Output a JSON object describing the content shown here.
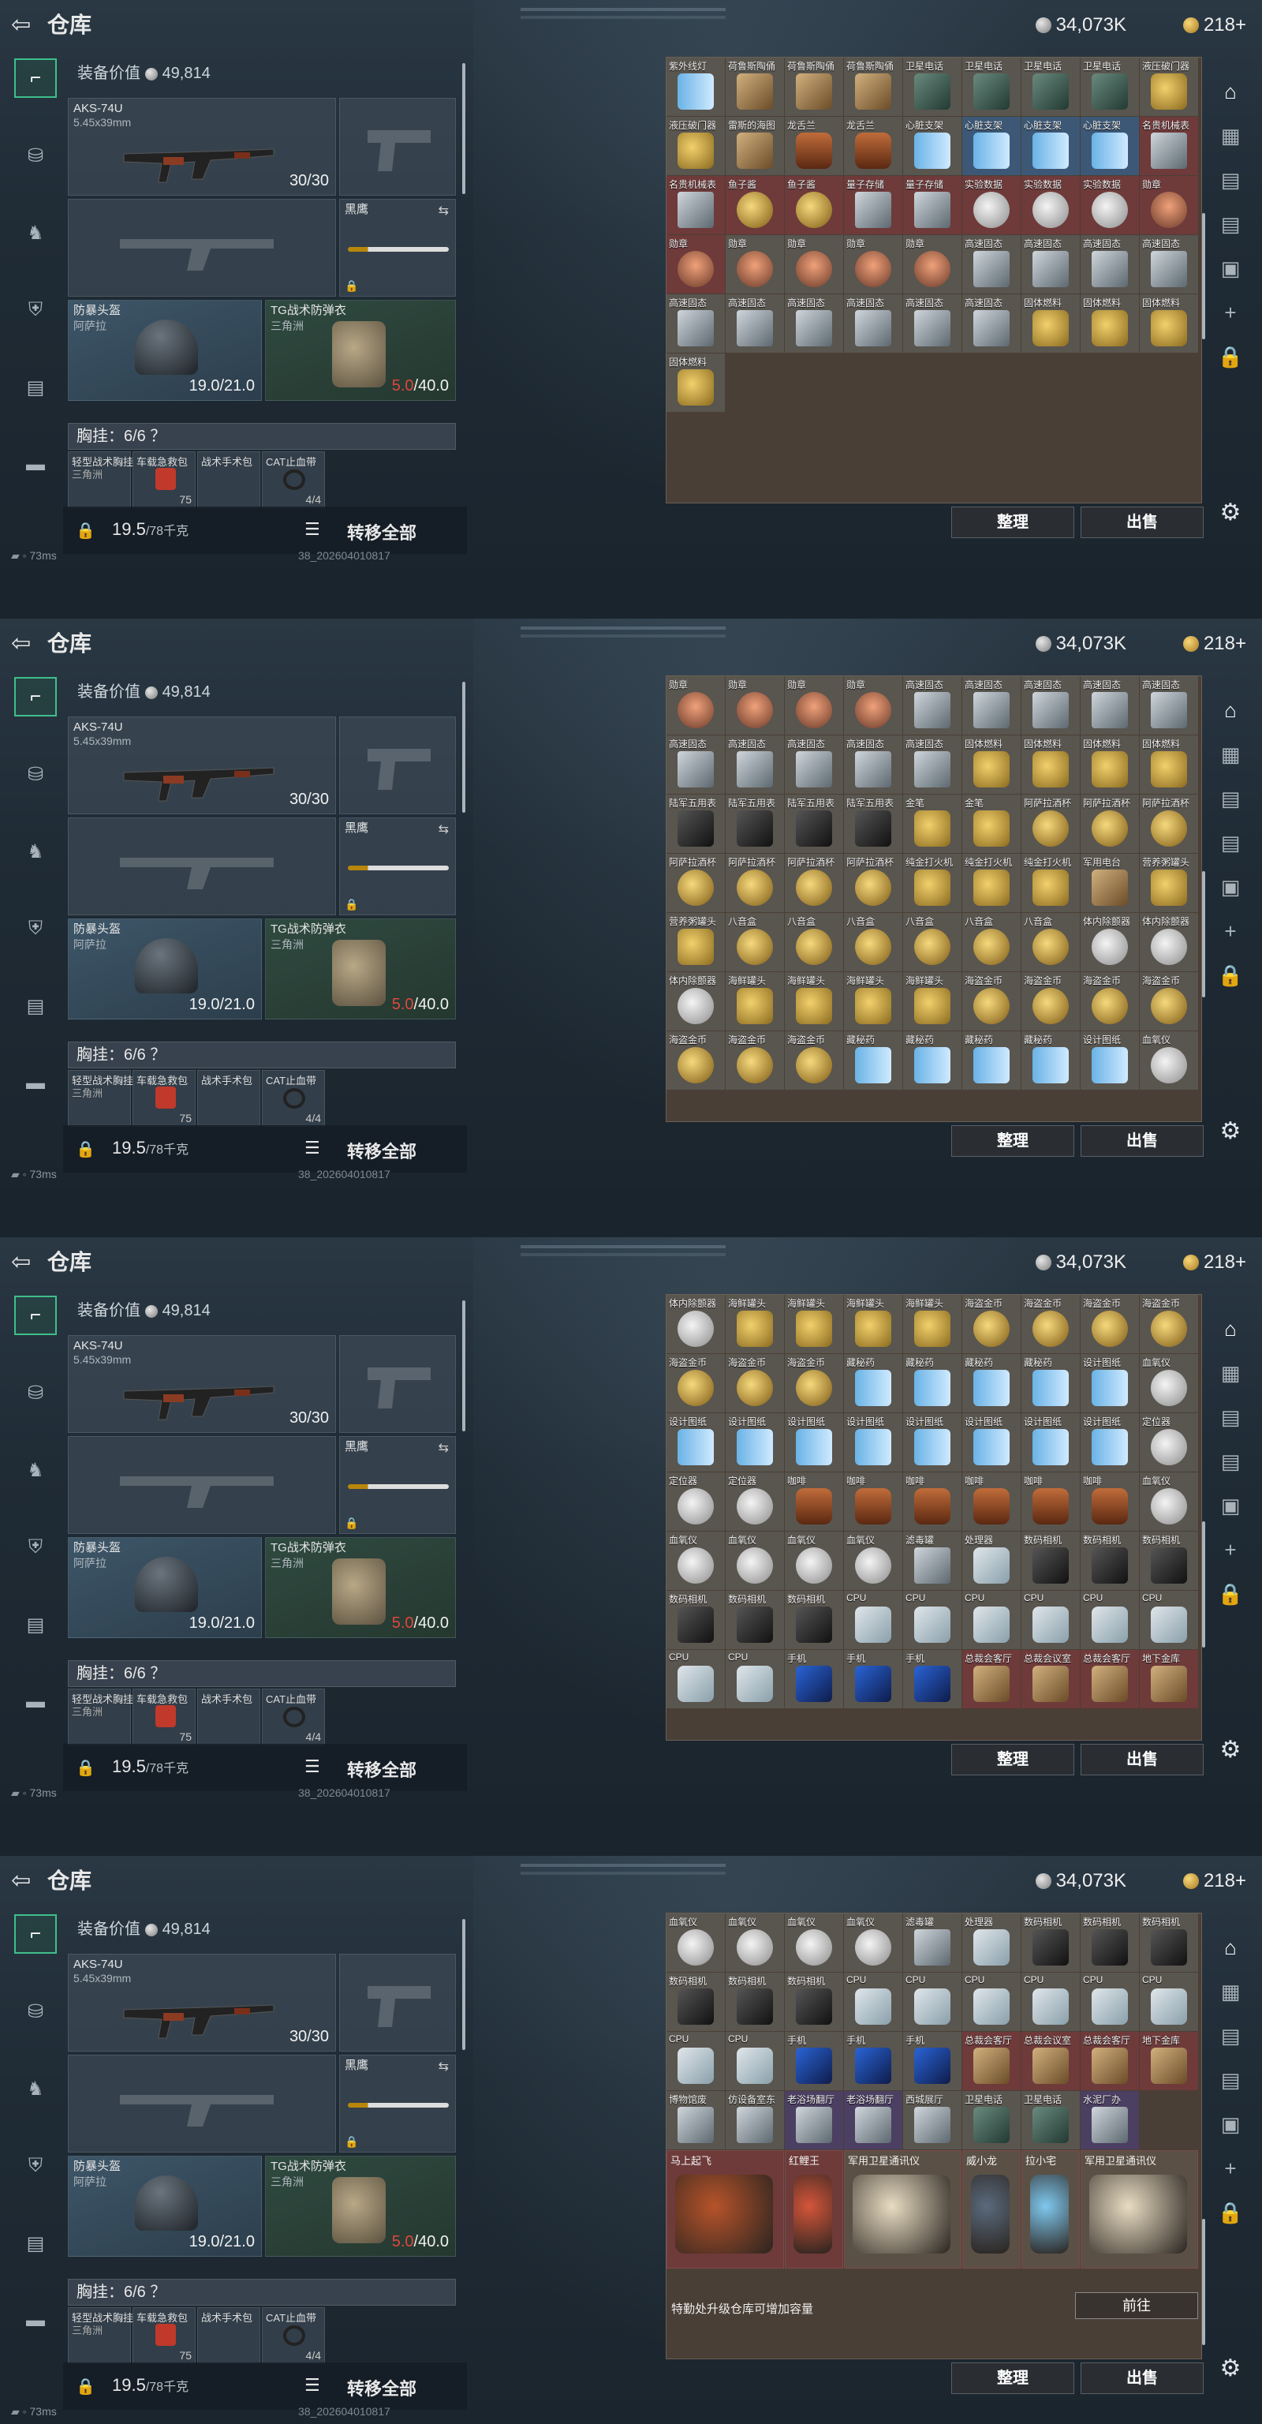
{
  "header": {
    "title": "仓库",
    "currency1": "34,073K",
    "currency2": "218+"
  },
  "footer": {
    "ping": "73ms",
    "build": "38_202604010817"
  },
  "equip": {
    "value_label": "装备价值",
    "value": "49,814",
    "weapon": {
      "name": "AKS-74U",
      "caliber": "5.45x39mm",
      "ammo": "30/30"
    },
    "knife": {
      "name": "黑鹰"
    },
    "helmet": {
      "name": "防暴头盔",
      "sub": "阿萨拉",
      "durability": "19.0/21.0"
    },
    "armor": {
      "name": "TG战术防弹衣",
      "sub": "三角洲",
      "cur": "5.0",
      "max": "/40.0"
    },
    "chest": "胸挂：6/6 ？",
    "pouches": [
      {
        "label": "轻型战术胸挂",
        "sub": "三角洲",
        "count": ""
      },
      {
        "label": "车载急救包",
        "sub": "",
        "count": "75"
      },
      {
        "label": "战术手术包",
        "sub": "",
        "count": ""
      },
      {
        "label": "CAT止血带",
        "sub": "",
        "count": "4/4"
      }
    ],
    "weight": "19.5",
    "weight_max": "/78千克",
    "transfer_all": "转移全部"
  },
  "warehouse": {
    "sort": "整理",
    "sell": "出售",
    "expand_note": "特勤处升级仓库可增加容量",
    "goto": "前往"
  },
  "grid1": [
    [
      "紫外线灯",
      "grey",
      "tube"
    ],
    [
      "荷鲁斯陶俑",
      "grey",
      "totem"
    ],
    [
      "荷鲁斯陶俑",
      "grey",
      "totem"
    ],
    [
      "荷鲁斯陶俑",
      "grey",
      "totem"
    ],
    [
      "卫星电话",
      "grey",
      "walkie"
    ],
    [
      "卫星电话",
      "grey",
      "walkie"
    ],
    [
      "卫星电话",
      "grey",
      "walkie"
    ],
    [
      "卫星电话",
      "grey",
      "walkie"
    ],
    [
      "液压破门器",
      "grey",
      "brass"
    ],
    [
      "液压破门器",
      "grey",
      "brass"
    ],
    [
      "雷斯的海图",
      "grey",
      "totem"
    ],
    [
      "龙舌兰",
      "grey",
      "bottle"
    ],
    [
      "龙舌兰",
      "grey",
      "bottle"
    ],
    [
      "心脏支架",
      "grey",
      "tube"
    ],
    [
      "心脏支架",
      "blue",
      "tube"
    ],
    [
      "心脏支架",
      "blue",
      "tube"
    ],
    [
      "心脏支架",
      "blue",
      "tube"
    ],
    [
      "名贵机械表",
      "red",
      "drive"
    ],
    [
      "名贵机械表",
      "red",
      "drive"
    ],
    [
      "鱼子酱",
      "red",
      "gold"
    ],
    [
      "鱼子酱",
      "red",
      "gold"
    ],
    [
      "量子存储",
      "red",
      "drive"
    ],
    [
      "量子存储",
      "red",
      "drive"
    ],
    [
      "实验数据",
      "red",
      "silver"
    ],
    [
      "实验数据",
      "red",
      "silver"
    ],
    [
      "实验数据",
      "red",
      "silver"
    ],
    [
      "勋章",
      "red",
      "medal"
    ],
    [
      "勋章",
      "red",
      "medal"
    ],
    [
      "勋章",
      "grey",
      "medal"
    ],
    [
      "勋章",
      "grey",
      "medal"
    ],
    [
      "勋章",
      "grey",
      "medal"
    ],
    [
      "勋章",
      "grey",
      "medal"
    ],
    [
      "高速固态",
      "grey",
      "drive"
    ],
    [
      "高速固态",
      "grey",
      "drive"
    ],
    [
      "高速固态",
      "grey",
      "drive"
    ],
    [
      "高速固态",
      "grey",
      "drive"
    ],
    [
      "高速固态",
      "grey",
      "drive"
    ],
    [
      "高速固态",
      "grey",
      "drive"
    ],
    [
      "高速固态",
      "grey",
      "drive"
    ],
    [
      "高速固态",
      "grey",
      "drive"
    ],
    [
      "高速固态",
      "grey",
      "drive"
    ],
    [
      "高速固态",
      "grey",
      "drive"
    ],
    [
      "固体燃料",
      "grey",
      "brass"
    ],
    [
      "固体燃料",
      "grey",
      "brass"
    ],
    [
      "固体燃料",
      "grey",
      "brass"
    ],
    [
      "固体燃料",
      "grey",
      "brass"
    ]
  ],
  "grid2": [
    [
      "勋章",
      "grey",
      "medal"
    ],
    [
      "勋章",
      "grey",
      "medal"
    ],
    [
      "勋章",
      "grey",
      "medal"
    ],
    [
      "勋章",
      "grey",
      "medal"
    ],
    [
      "高速固态",
      "grey",
      "drive"
    ],
    [
      "高速固态",
      "grey",
      "drive"
    ],
    [
      "高速固态",
      "grey",
      "drive"
    ],
    [
      "高速固态",
      "grey",
      "drive"
    ],
    [
      "高速固态",
      "grey",
      "drive"
    ],
    [
      "高速固态",
      "grey",
      "drive"
    ],
    [
      "高速固态",
      "grey",
      "drive"
    ],
    [
      "高速固态",
      "grey",
      "drive"
    ],
    [
      "高速固态",
      "grey",
      "drive"
    ],
    [
      "高速固态",
      "grey",
      "drive"
    ],
    [
      "固体燃料",
      "grey",
      "brass"
    ],
    [
      "固体燃料",
      "grey",
      "brass"
    ],
    [
      "固体燃料",
      "grey",
      "brass"
    ],
    [
      "固体燃料",
      "grey",
      "brass"
    ],
    [
      "陆军五用表",
      "grey",
      "camera"
    ],
    [
      "陆军五用表",
      "grey",
      "camera"
    ],
    [
      "陆军五用表",
      "grey",
      "camera"
    ],
    [
      "陆军五用表",
      "grey",
      "camera"
    ],
    [
      "金笔",
      "grey",
      "brass"
    ],
    [
      "金笔",
      "grey",
      "brass"
    ],
    [
      "阿萨拉酒杯",
      "grey",
      "gold"
    ],
    [
      "阿萨拉酒杯",
      "grey",
      "gold"
    ],
    [
      "阿萨拉酒杯",
      "grey",
      "gold"
    ],
    [
      "阿萨拉酒杯",
      "grey",
      "gold"
    ],
    [
      "阿萨拉酒杯",
      "grey",
      "gold"
    ],
    [
      "阿萨拉酒杯",
      "grey",
      "gold"
    ],
    [
      "阿萨拉酒杯",
      "grey",
      "gold"
    ],
    [
      "纯金打火机",
      "grey",
      "brass"
    ],
    [
      "纯金打火机",
      "grey",
      "brass"
    ],
    [
      "纯金打火机",
      "grey",
      "brass"
    ],
    [
      "军用电台",
      "grey",
      "totem"
    ],
    [
      "营养粥罐头",
      "grey",
      "brass"
    ],
    [
      "营养粥罐头",
      "grey",
      "brass"
    ],
    [
      "八音盒",
      "grey",
      "gold"
    ],
    [
      "八音盒",
      "grey",
      "gold"
    ],
    [
      "八音盒",
      "grey",
      "gold"
    ],
    [
      "八音盒",
      "grey",
      "gold"
    ],
    [
      "八音盒",
      "grey",
      "gold"
    ],
    [
      "八音盒",
      "grey",
      "gold"
    ],
    [
      "体内除颤器",
      "grey",
      "silver"
    ],
    [
      "体内除颤器",
      "grey",
      "silver"
    ],
    [
      "体内除颤器",
      "grey",
      "silver"
    ],
    [
      "海鲜罐头",
      "grey",
      "brass"
    ],
    [
      "海鲜罐头",
      "grey",
      "brass"
    ],
    [
      "海鲜罐头",
      "grey",
      "brass"
    ],
    [
      "海鲜罐头",
      "grey",
      "brass"
    ],
    [
      "海盗金币",
      "grey",
      "gold"
    ],
    [
      "海盗金币",
      "grey",
      "gold"
    ],
    [
      "海盗金币",
      "grey",
      "gold"
    ],
    [
      "海盗金币",
      "grey",
      "gold"
    ],
    [
      "海盗金币",
      "grey",
      "gold"
    ],
    [
      "海盗金币",
      "grey",
      "gold"
    ],
    [
      "海盗金币",
      "grey",
      "gold"
    ],
    [
      "藏秘药",
      "grey",
      "tube"
    ],
    [
      "藏秘药",
      "grey",
      "tube"
    ],
    [
      "藏秘药",
      "grey",
      "tube"
    ],
    [
      "藏秘药",
      "grey",
      "tube"
    ],
    [
      "设计图纸",
      "grey",
      "tube"
    ],
    [
      "血氧仪",
      "grey",
      "silver"
    ]
  ],
  "grid3": [
    [
      "体内除颤器",
      "grey",
      "silver"
    ],
    [
      "海鲜罐头",
      "grey",
      "brass"
    ],
    [
      "海鲜罐头",
      "grey",
      "brass"
    ],
    [
      "海鲜罐头",
      "grey",
      "brass"
    ],
    [
      "海鲜罐头",
      "grey",
      "brass"
    ],
    [
      "海盗金币",
      "grey",
      "gold"
    ],
    [
      "海盗金币",
      "grey",
      "gold"
    ],
    [
      "海盗金币",
      "grey",
      "gold"
    ],
    [
      "海盗金币",
      "grey",
      "gold"
    ],
    [
      "海盗金币",
      "grey",
      "gold"
    ],
    [
      "海盗金币",
      "grey",
      "gold"
    ],
    [
      "海盗金币",
      "grey",
      "gold"
    ],
    [
      "藏秘药",
      "grey",
      "tube"
    ],
    [
      "藏秘药",
      "grey",
      "tube"
    ],
    [
      "藏秘药",
      "grey",
      "tube"
    ],
    [
      "藏秘药",
      "grey",
      "tube"
    ],
    [
      "设计图纸",
      "grey",
      "tube"
    ],
    [
      "血氧仪",
      "grey",
      "silver"
    ],
    [
      "设计图纸",
      "grey",
      "tube"
    ],
    [
      "设计图纸",
      "grey",
      "tube"
    ],
    [
      "设计图纸",
      "grey",
      "tube"
    ],
    [
      "设计图纸",
      "grey",
      "tube"
    ],
    [
      "设计图纸",
      "grey",
      "tube"
    ],
    [
      "设计图纸",
      "grey",
      "tube"
    ],
    [
      "设计图纸",
      "grey",
      "tube"
    ],
    [
      "设计图纸",
      "grey",
      "tube"
    ],
    [
      "定位器",
      "grey",
      "silver"
    ],
    [
      "定位器",
      "grey",
      "silver"
    ],
    [
      "定位器",
      "grey",
      "silver"
    ],
    [
      "咖啡",
      "grey",
      "bottle"
    ],
    [
      "咖啡",
      "grey",
      "bottle"
    ],
    [
      "咖啡",
      "grey",
      "bottle"
    ],
    [
      "咖啡",
      "grey",
      "bottle"
    ],
    [
      "咖啡",
      "grey",
      "bottle"
    ],
    [
      "咖啡",
      "grey",
      "bottle"
    ],
    [
      "血氧仪",
      "grey",
      "silver"
    ],
    [
      "血氧仪",
      "grey",
      "silver"
    ],
    [
      "血氧仪",
      "grey",
      "silver"
    ],
    [
      "血氧仪",
      "grey",
      "silver"
    ],
    [
      "血氧仪",
      "grey",
      "silver"
    ],
    [
      "滤毒罐",
      "grey",
      "drive"
    ],
    [
      "处理器",
      "grey",
      "pcb"
    ],
    [
      "数码相机",
      "grey",
      "camera"
    ],
    [
      "数码相机",
      "grey",
      "camera"
    ],
    [
      "数码相机",
      "grey",
      "camera"
    ],
    [
      "数码相机",
      "grey",
      "camera"
    ],
    [
      "数码相机",
      "grey",
      "camera"
    ],
    [
      "数码相机",
      "grey",
      "camera"
    ],
    [
      "CPU",
      "grey",
      "pcb"
    ],
    [
      "CPU",
      "grey",
      "pcb"
    ],
    [
      "CPU",
      "grey",
      "pcb"
    ],
    [
      "CPU",
      "grey",
      "pcb"
    ],
    [
      "CPU",
      "grey",
      "pcb"
    ],
    [
      "CPU",
      "grey",
      "pcb"
    ],
    [
      "CPU",
      "grey",
      "pcb"
    ],
    [
      "CPU",
      "grey",
      "pcb"
    ],
    [
      "手机",
      "grey",
      "phone"
    ],
    [
      "手机",
      "grey",
      "phone"
    ],
    [
      "手机",
      "grey",
      "phone"
    ],
    [
      "总裁会客厅",
      "red",
      "totem"
    ],
    [
      "总裁会议室",
      "red",
      "totem"
    ],
    [
      "总裁会客厅",
      "red",
      "totem"
    ],
    [
      "地下金库",
      "red",
      "totem"
    ]
  ],
  "grid4": [
    [
      "血氧仪",
      "grey",
      "silver"
    ],
    [
      "血氧仪",
      "grey",
      "silver"
    ],
    [
      "血氧仪",
      "grey",
      "silver"
    ],
    [
      "血氧仪",
      "grey",
      "silver"
    ],
    [
      "滤毒罐",
      "grey",
      "drive"
    ],
    [
      "处理器",
      "grey",
      "pcb"
    ],
    [
      "数码相机",
      "grey",
      "camera"
    ],
    [
      "数码相机",
      "grey",
      "camera"
    ],
    [
      "数码相机",
      "grey",
      "camera"
    ],
    [
      "数码相机",
      "grey",
      "camera"
    ],
    [
      "数码相机",
      "grey",
      "camera"
    ],
    [
      "数码相机",
      "grey",
      "camera"
    ],
    [
      "CPU",
      "grey",
      "pcb"
    ],
    [
      "CPU",
      "grey",
      "pcb"
    ],
    [
      "CPU",
      "grey",
      "pcb"
    ],
    [
      "CPU",
      "grey",
      "pcb"
    ],
    [
      "CPU",
      "grey",
      "pcb"
    ],
    [
      "CPU",
      "grey",
      "pcb"
    ],
    [
      "CPU",
      "grey",
      "pcb"
    ],
    [
      "CPU",
      "grey",
      "pcb"
    ],
    [
      "手机",
      "grey",
      "phone"
    ],
    [
      "手机",
      "grey",
      "phone"
    ],
    [
      "手机",
      "grey",
      "phone"
    ],
    [
      "总裁会客厅",
      "red",
      "totem"
    ],
    [
      "总裁会议室",
      "red",
      "totem"
    ],
    [
      "总裁会客厅",
      "red",
      "totem"
    ],
    [
      "地下金库",
      "red",
      "totem"
    ],
    [
      "博物馆废",
      "grey",
      "drive"
    ],
    [
      "仿设备室东",
      "grey",
      "drive"
    ],
    [
      "老浴场翻厅",
      "purple",
      "drive"
    ],
    [
      "老浴场翻厅",
      "purple",
      "drive"
    ],
    [
      "西城展厅",
      "grey",
      "drive"
    ],
    [
      "卫星电话",
      "grey",
      "walkie"
    ],
    [
      "卫星电话",
      "grey",
      "walkie"
    ],
    [
      "水泥厂办",
      "purple",
      "drive"
    ]
  ],
  "big4": [
    {
      "label": "马上起飞",
      "w": 150
    },
    {
      "label": "红鲤王",
      "w": 75
    },
    {
      "label": "军用卫星通讯仪",
      "w": 150
    },
    {
      "label": "威小龙",
      "w": 75
    },
    {
      "label": "拉小宅",
      "w": 75
    },
    {
      "label": "军用卫星通讯仪",
      "w": 150
    }
  ],
  "nav": {
    "left": [
      "pistol-icon",
      "backpack-icon",
      "helmet-icon",
      "lock-bag-icon",
      "clipboard-icon",
      "briefcase-icon"
    ],
    "right": [
      "safe-icon",
      "chart-icon",
      "folder-icon",
      "folder-icon",
      "plus-folder-icon",
      "plus-icon",
      "lock-icon"
    ]
  }
}
